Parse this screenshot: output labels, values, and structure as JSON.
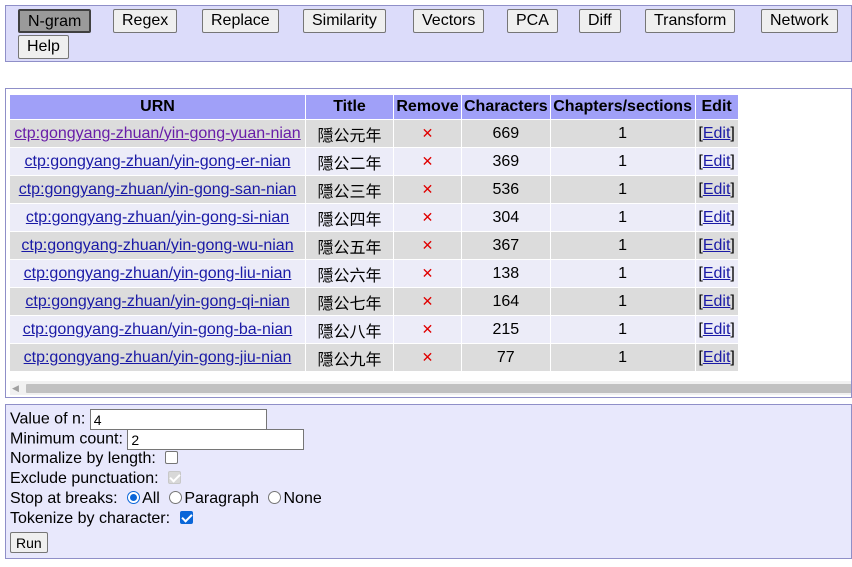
{
  "toolbar": {
    "buttons": [
      "N-gram",
      "Regex",
      "Replace",
      "Similarity",
      "Vectors",
      "PCA",
      "Diff",
      "Transform",
      "Network",
      "Help"
    ],
    "active": "N-gram"
  },
  "table": {
    "headers": [
      "URN",
      "Title",
      "Remove",
      "Characters",
      "Chapters/sections",
      "Edit"
    ],
    "remove_glyph": "✕",
    "edit_label": "Edit",
    "rows": [
      {
        "urn": "ctp:gongyang-zhuan/yin-gong-yuan-nian",
        "title": "隱公元年",
        "characters": "669",
        "chapters": "1"
      },
      {
        "urn": "ctp:gongyang-zhuan/yin-gong-er-nian",
        "title": "隱公二年",
        "characters": "369",
        "chapters": "1"
      },
      {
        "urn": "ctp:gongyang-zhuan/yin-gong-san-nian",
        "title": "隱公三年",
        "characters": "536",
        "chapters": "1"
      },
      {
        "urn": "ctp:gongyang-zhuan/yin-gong-si-nian",
        "title": "隱公四年",
        "characters": "304",
        "chapters": "1"
      },
      {
        "urn": "ctp:gongyang-zhuan/yin-gong-wu-nian",
        "title": "隱公五年",
        "characters": "367",
        "chapters": "1"
      },
      {
        "urn": "ctp:gongyang-zhuan/yin-gong-liu-nian",
        "title": "隱公六年",
        "characters": "138",
        "chapters": "1"
      },
      {
        "urn": "ctp:gongyang-zhuan/yin-gong-qi-nian",
        "title": "隱公七年",
        "characters": "164",
        "chapters": "1"
      },
      {
        "urn": "ctp:gongyang-zhuan/yin-gong-ba-nian",
        "title": "隱公八年",
        "characters": "215",
        "chapters": "1"
      },
      {
        "urn": "ctp:gongyang-zhuan/yin-gong-jiu-nian",
        "title": "隱公九年",
        "characters": "77",
        "chapters": "1"
      }
    ]
  },
  "options": {
    "n_label": "Value of n:",
    "n_value": "4",
    "min_count_label": "Minimum count:",
    "min_count_value": "2",
    "normalize_label": "Normalize by length:",
    "normalize_checked": false,
    "exclude_punct_label": "Exclude punctuation:",
    "exclude_punct_checked": true,
    "stop_label": "Stop at breaks:",
    "stop_options": [
      "All",
      "Paragraph",
      "None"
    ],
    "stop_selected": "All",
    "tokenize_label": "Tokenize by character:",
    "tokenize_checked": true,
    "run_label": "Run"
  },
  "colors": {
    "toolbar_bg": "#dcdcfa",
    "header_bg": "#a0a0f8",
    "row_odd": "#dcdcdc",
    "row_even": "#ececf8",
    "remove_red": "#e00000",
    "link_blue": "#1a1aa6"
  }
}
